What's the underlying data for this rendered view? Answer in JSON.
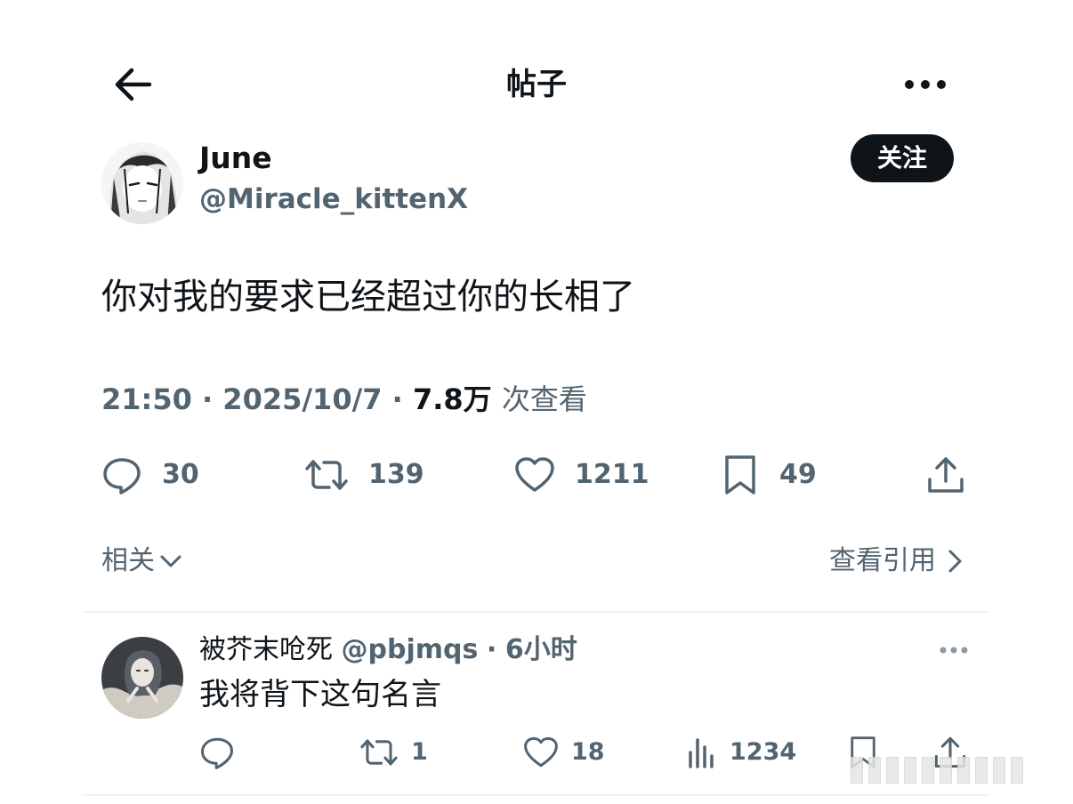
{
  "header": {
    "title": "帖子",
    "back_icon": "arrow-left-icon",
    "more_icon": "more-dots-icon"
  },
  "post": {
    "author_name": "June",
    "author_handle": "@Miracle_kittenX",
    "follow_label": "关注",
    "text": "你对我的要求已经超过你的长相了",
    "time": "21:50",
    "date": "2025/10/7",
    "separator": "·",
    "views_count": "7.8万",
    "views_label": "次查看",
    "actions": {
      "replies": "30",
      "reposts": "139",
      "likes": "1211",
      "bookmarks": "49"
    }
  },
  "related_label": "相关",
  "quotes_label": "查看引用",
  "reply": {
    "author_name": "被芥末呛死",
    "author_handle": "@pbjmqs",
    "time_ago": "6小时",
    "separator": "·",
    "text": "我将背下这句名言",
    "actions": {
      "replies": "",
      "reposts": "1",
      "likes": "18",
      "views": "1234"
    }
  },
  "colors": {
    "text_primary": "#0f1419",
    "text_secondary": "#536471",
    "divider": "#eff3f4",
    "button_bg": "#0f1419"
  }
}
